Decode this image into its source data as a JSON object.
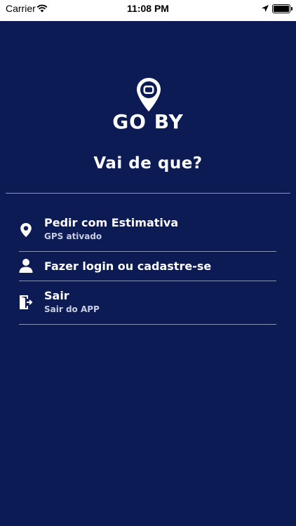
{
  "status_bar": {
    "carrier": "Carrier",
    "time": "11:08 PM",
    "battery_level": 1.0
  },
  "logo": {
    "text": "GO BY",
    "icon": "location-pin-icon"
  },
  "heading": "Vai de que?",
  "menu": [
    {
      "title": "Pedir com Estimativa",
      "subtitle": "GPS ativado",
      "icon": "location-marker-icon"
    },
    {
      "title": "Fazer login ou cadastre-se",
      "subtitle": "",
      "icon": "user-icon"
    },
    {
      "title": "Sair",
      "subtitle": "Sair do APP",
      "icon": "exit-door-icon"
    }
  ],
  "colors": {
    "background": "#0c1b54",
    "text": "#ffffff",
    "divider": "#8a93b8",
    "status_bar": "#ffffff"
  }
}
